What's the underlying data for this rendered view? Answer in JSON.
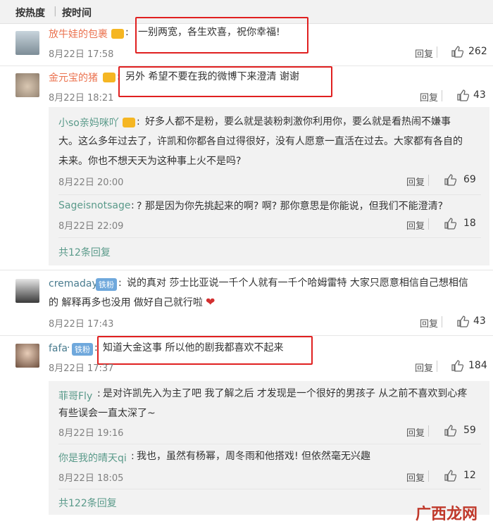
{
  "sort": {
    "hot": "按热度",
    "time": "按时间"
  },
  "comments": [
    {
      "user": "放牛娃的包裹",
      "text": "一别两宽，各生欢喜，祝你幸福!",
      "time": "8月22日 17:58",
      "reply": "回复",
      "likes": "262"
    },
    {
      "user": "金元宝的猪",
      "text": "另外 希望不要在我的微博下来澄清 谢谢",
      "time": "8月22日 18:21",
      "reply": "回复",
      "likes": "43",
      "subs": [
        {
          "user": "小so亲妈咪吖",
          "text1": "好多人都不是粉，要么就是装粉刺激你利用你，要么就是看热闹不嫌事",
          "text2": "大。这么多年过去了，许凯和你都各自过得很好，没有人愿意一直活在过去。大家都有各自的",
          "text3": "未来。你也不想天天为这种事上火不是吗?",
          "time": "8月22日 20:00",
          "reply": "回复",
          "likes": "69"
        },
        {
          "user": "Sageisnotsage",
          "text1": "? 那是因为你先挑起来的啊? 啊? 那你意思是你能说，但我们不能澄清?",
          "time": "8月22日 22:09",
          "reply": "回复",
          "likes": "18"
        }
      ],
      "more": "共12条回复"
    },
    {
      "user": "cremaday",
      "badge": "铁粉",
      "text1": "说的真对 莎士比亚说一千个人就有一千个哈姆雷特 大家只愿意相信自己想相信",
      "text2": "的 解释再多也没用 做好自己就行啦",
      "time": "8月22日 17:43",
      "reply": "回复",
      "likes": "43"
    },
    {
      "user": "fafa",
      "badge": "铁粉",
      "text": "知道大金这事 所以他的剧我都喜欢不起来",
      "time": "8月22日 17:37",
      "reply": "回复",
      "likes": "184",
      "subs": [
        {
          "user": "菲哥Fly",
          "text1": "是对许凯先入为主了吧 我了解之后 才发现是一个很好的男孩子 从之前不喜欢到心疼",
          "text2": "有些误会一直太深了~",
          "time": "8月22日 19:16",
          "reply": "回复",
          "likes": "59"
        },
        {
          "user": "你是我的晴天qi",
          "text1": "我也，虽然有杨幂，周冬雨和他搭戏! 但依然毫无兴趣",
          "time": "8月22日 18:05",
          "reply": "回复",
          "likes": "12"
        }
      ],
      "more": "共122条回复"
    }
  ],
  "watermark": "广西龙网"
}
